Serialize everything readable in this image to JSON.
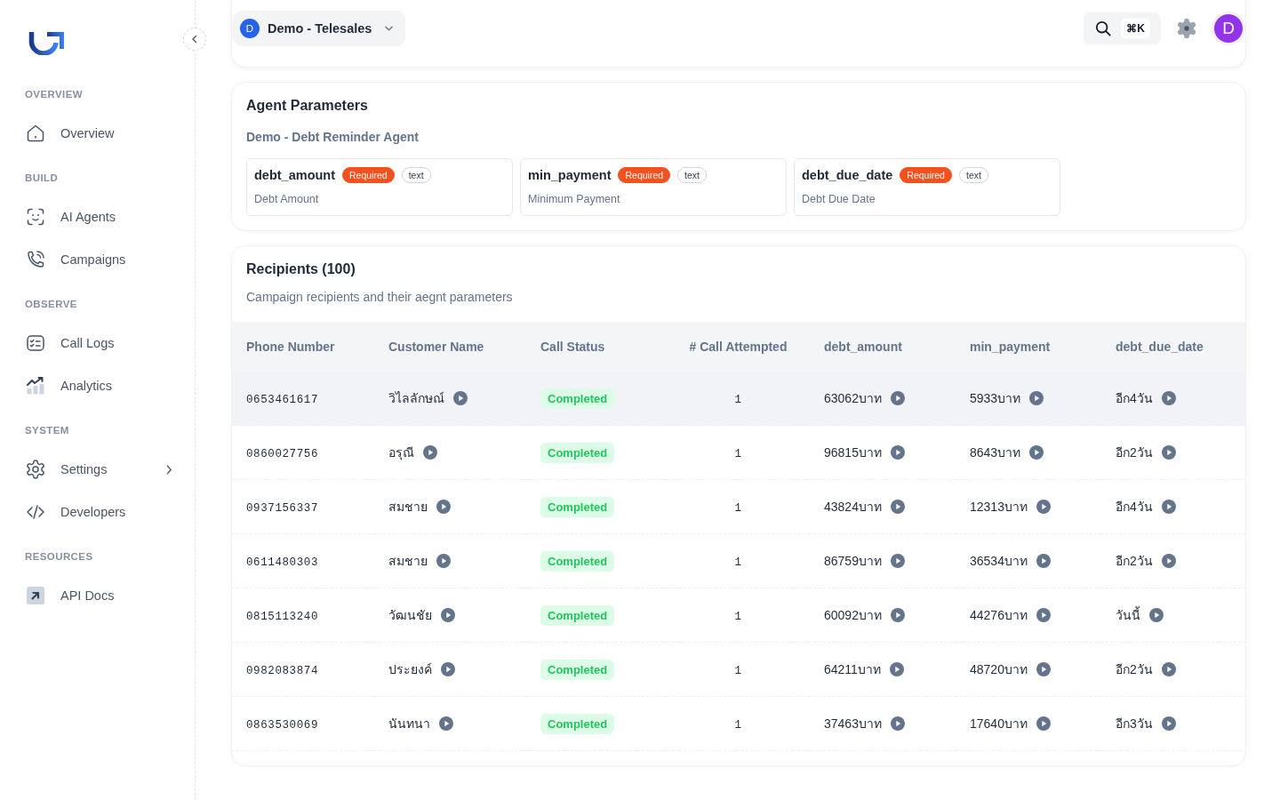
{
  "sidebar": {
    "sections": [
      {
        "title": "OVERVIEW",
        "items": [
          {
            "label": "Overview",
            "expandable": false
          }
        ]
      },
      {
        "title": "BUILD",
        "items": [
          {
            "label": "AI Agents",
            "expandable": false
          },
          {
            "label": "Campaigns",
            "expandable": false
          }
        ]
      },
      {
        "title": "OBSERVE",
        "items": [
          {
            "label": "Call Logs",
            "expandable": false
          },
          {
            "label": "Analytics",
            "expandable": false
          }
        ]
      },
      {
        "title": "SYSTEM",
        "items": [
          {
            "label": "Settings",
            "expandable": true
          },
          {
            "label": "Developers",
            "expandable": false
          }
        ]
      },
      {
        "title": "RESOURCES",
        "items": [
          {
            "label": "API Docs",
            "expandable": false
          }
        ]
      }
    ]
  },
  "top_bar": {
    "workspace": {
      "initial": "D",
      "name": "Demo - Telesales"
    },
    "search": {
      "shortcut": "⌘K"
    },
    "avatar": {
      "initial": "D"
    }
  },
  "agent_parameters": {
    "title": "Agent Parameters",
    "agent_name": "Demo - Debt Reminder Agent",
    "parameters": [
      {
        "name": "debt_amount",
        "badges": [
          {
            "label": "Required",
            "kind": "required"
          },
          {
            "label": "text",
            "kind": "type"
          }
        ],
        "description": "Debt Amount"
      },
      {
        "name": "min_payment",
        "badges": [
          {
            "label": "Required",
            "kind": "required"
          },
          {
            "label": "text",
            "kind": "type"
          }
        ],
        "description": "Minimum Payment"
      },
      {
        "name": "debt_due_date",
        "badges": [
          {
            "label": "Required",
            "kind": "required"
          },
          {
            "label": "text",
            "kind": "type"
          }
        ],
        "description": "Debt Due Date"
      }
    ]
  },
  "recipients": {
    "title": "Recipients (100)",
    "description": "Campaign recipients and their aegnt parameters",
    "table": {
      "columns": [
        {
          "label": "Phone Number",
          "kind": "phone"
        },
        {
          "label": "Customer Name",
          "kind": "playable"
        },
        {
          "label": "Call Status",
          "kind": "status"
        },
        {
          "label": "# Call Attempted",
          "kind": "count"
        },
        {
          "label": "debt_amount",
          "kind": "playable"
        },
        {
          "label": "min_payment",
          "kind": "playable"
        },
        {
          "label": "debt_due_date",
          "kind": "playable"
        }
      ],
      "rows": [
        {
          "highlighted": true,
          "cells": [
            "0653461617",
            "วิไลลักษณ์",
            "Completed",
            "1",
            "63062บาท",
            "5933บาท",
            "อีก4วัน"
          ]
        },
        {
          "highlighted": false,
          "cells": [
            "0860027756",
            "อรุณี",
            "Completed",
            "1",
            "96815บาท",
            "8643บาท",
            "อีก2วัน"
          ]
        },
        {
          "highlighted": false,
          "cells": [
            "0937156337",
            "สมชาย",
            "Completed",
            "1",
            "43824บาท",
            "12313บาท",
            "อีก4วัน"
          ]
        },
        {
          "highlighted": false,
          "cells": [
            "0611480303",
            "สมชาย",
            "Completed",
            "1",
            "86759บาท",
            "36534บาท",
            "อีก2วัน"
          ]
        },
        {
          "highlighted": false,
          "cells": [
            "0815113240",
            "วัฒนชัย",
            "Completed",
            "1",
            "60092บาท",
            "44276บาท",
            "วันนี้"
          ]
        },
        {
          "highlighted": false,
          "cells": [
            "0982083874",
            "ประยงค์",
            "Completed",
            "1",
            "64211บาท",
            "48720บาท",
            "อีก2วัน"
          ]
        },
        {
          "highlighted": false,
          "cells": [
            "0863530069",
            "นันทนา",
            "Completed",
            "1",
            "37463บาท",
            "17640บาท",
            "อีก3วัน"
          ]
        }
      ]
    }
  }
}
